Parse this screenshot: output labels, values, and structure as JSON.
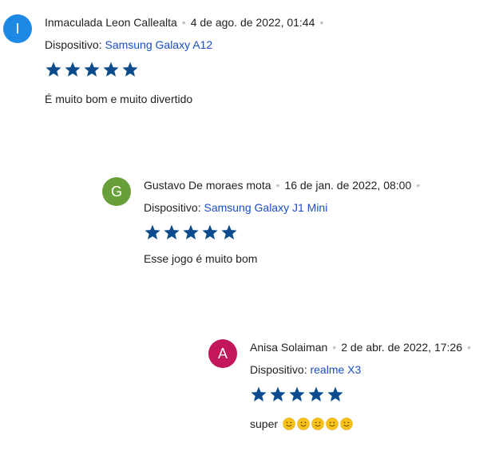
{
  "reviews": [
    {
      "avatar_letter": "I",
      "avatar_color": "#1e88e5",
      "author": "Inmaculada Leon Callealta",
      "date": "4 de ago. de 2022, 01:44",
      "device_label": "Dispositivo:",
      "device": "Samsung Galaxy A12",
      "rating": 5,
      "text": "É muito bom e muito divertido"
    },
    {
      "avatar_letter": "G",
      "avatar_color": "#689f38",
      "author": "Gustavo De moraes mota",
      "date": "16 de jan. de 2022, 08:00",
      "device_label": "Dispositivo:",
      "device": "Samsung Galaxy J1 Mini",
      "rating": 5,
      "text": "Esse jogo é muito bom"
    },
    {
      "avatar_letter": "A",
      "avatar_color": "#c2185b",
      "author": "Anisa Solaiman",
      "date": "2 de abr. de 2022, 17:26",
      "device_label": "Dispositivo:",
      "device": "realme X3",
      "rating": 5,
      "text": "super",
      "emojis": [
        "slightly-smiling-face",
        "slightly-smiling-face",
        "slightly-smiling-face",
        "slightly-smiling-face",
        "slightly-smiling-face"
      ]
    }
  ],
  "star_color": "#0b4d8c",
  "separator_symbol": "•"
}
